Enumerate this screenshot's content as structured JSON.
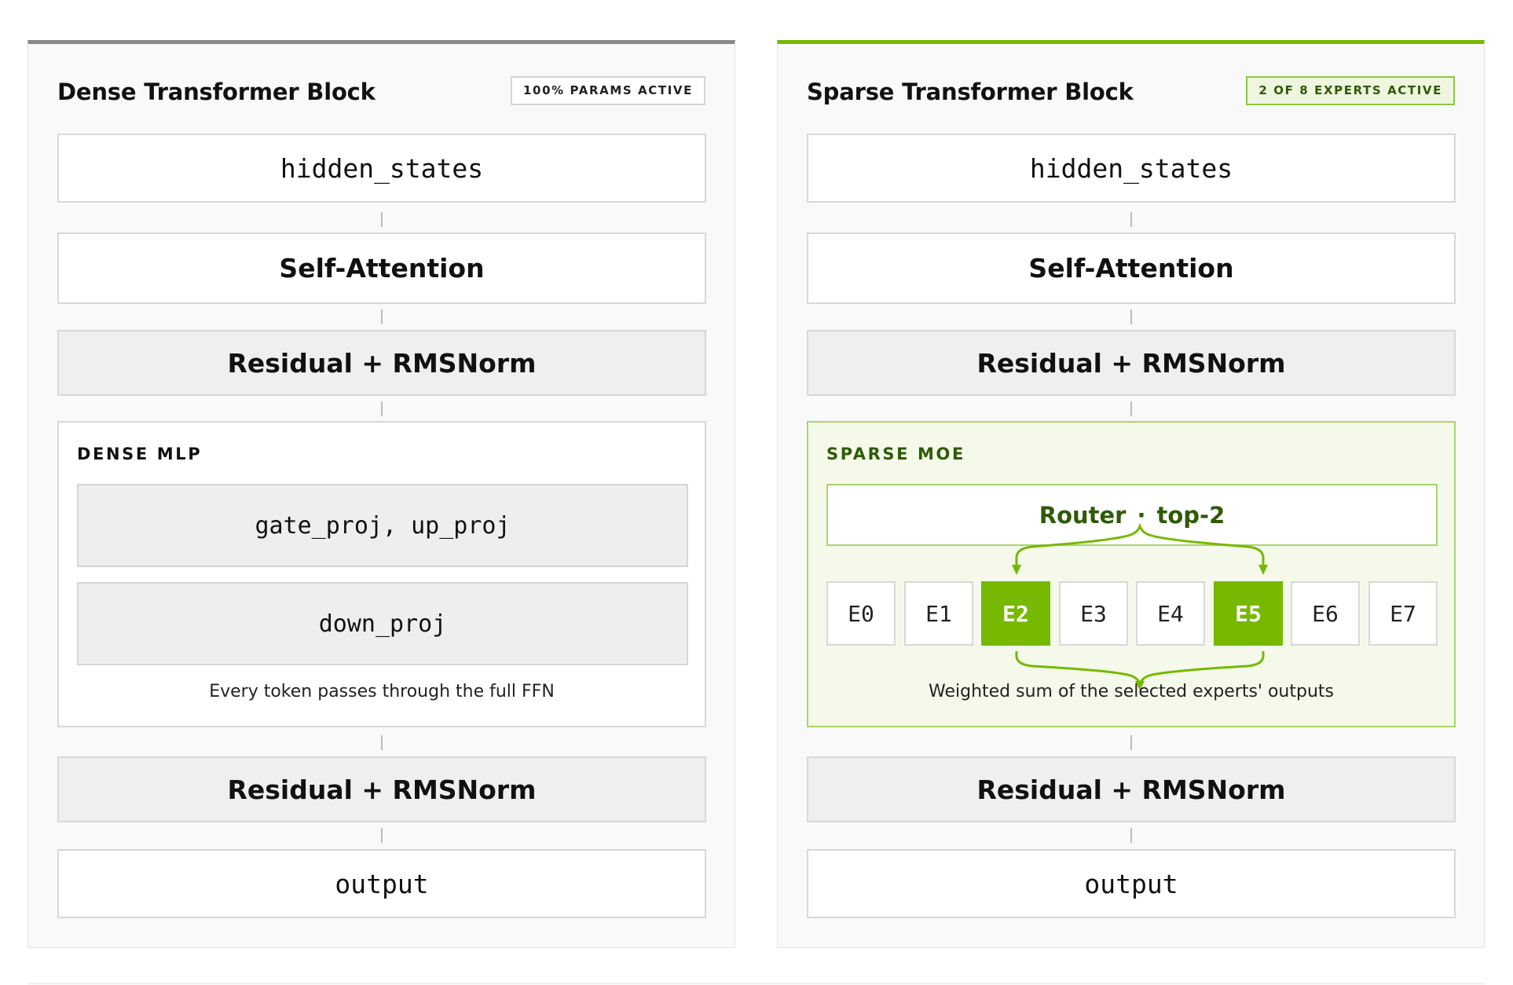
{
  "colors": {
    "accent": "#76b900",
    "accent_dark": "#2f5a06",
    "dense_rule": "#8a8a8a"
  },
  "dense": {
    "title": "Dense Transformer Block",
    "badge": "100% PARAMS ACTIVE",
    "input": "hidden_states",
    "attention": "Self-Attention",
    "norm1": "Residual + RMSNorm",
    "section_title": "DENSE MLP",
    "proj1": "gate_proj, up_proj",
    "proj2": "down_proj",
    "caption": "Every token passes through the full FFN",
    "norm2": "Residual + RMSNorm",
    "output": "output"
  },
  "sparse": {
    "title": "Sparse Transformer Block",
    "badge": "2 OF 8 EXPERTS ACTIVE",
    "input": "hidden_states",
    "attention": "Self-Attention",
    "norm1": "Residual + RMSNorm",
    "section_title": "SPARSE MOE",
    "router_label": "Router",
    "router_sep": "·",
    "router_topk": "top-2",
    "experts": [
      {
        "label": "E0",
        "active": false
      },
      {
        "label": "E1",
        "active": false
      },
      {
        "label": "E2",
        "active": true
      },
      {
        "label": "E3",
        "active": false
      },
      {
        "label": "E4",
        "active": false
      },
      {
        "label": "E5",
        "active": true
      },
      {
        "label": "E6",
        "active": false
      },
      {
        "label": "E7",
        "active": false
      }
    ],
    "caption": "Weighted sum of the selected experts' outputs",
    "norm2": "Residual + RMSNorm",
    "output": "output"
  }
}
